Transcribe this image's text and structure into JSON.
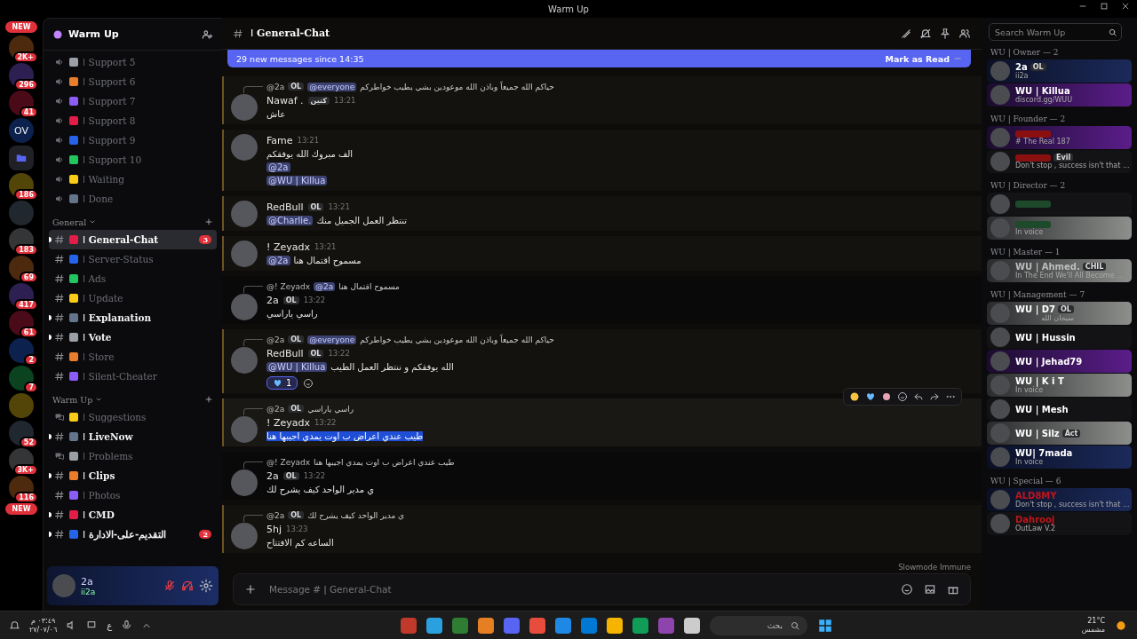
{
  "window": {
    "title": "Warm Up"
  },
  "servers": [
    {
      "kind": "new",
      "badge": "NEW"
    },
    {
      "kind": "server",
      "badge": "2K+"
    },
    {
      "kind": "server",
      "badge": "296"
    },
    {
      "kind": "server",
      "badge": "41"
    },
    {
      "kind": "server",
      "label": "OV"
    },
    {
      "kind": "folder"
    },
    {
      "kind": "server",
      "badge": "186"
    },
    {
      "kind": "server"
    },
    {
      "kind": "server",
      "badge": "183"
    },
    {
      "kind": "server",
      "badge": "69"
    },
    {
      "kind": "server",
      "badge": "417"
    },
    {
      "kind": "server",
      "badge": "61"
    },
    {
      "kind": "server",
      "badge": "2"
    },
    {
      "kind": "server",
      "badge": "7"
    },
    {
      "kind": "server"
    },
    {
      "kind": "server",
      "badge": "52"
    },
    {
      "kind": "server",
      "badge": "3K+"
    },
    {
      "kind": "server",
      "badge": "116"
    },
    {
      "kind": "new",
      "badge": "NEW"
    }
  ],
  "server": {
    "name": "Warm Up"
  },
  "channel_groups": [
    {
      "channels": [
        {
          "kind": "voice",
          "name": "ǀ Support 5",
          "unread": false,
          "selected": false
        },
        {
          "kind": "voice",
          "name": "ǀ Support 6",
          "unread": false,
          "selected": false
        },
        {
          "kind": "voice",
          "name": "ǀ Support 7",
          "unread": false,
          "selected": false
        },
        {
          "kind": "voice",
          "name": "ǀ Support 8",
          "unread": false,
          "selected": false
        },
        {
          "kind": "voice",
          "name": "ǀ Support 9",
          "unread": false,
          "selected": false
        },
        {
          "kind": "voice",
          "name": "ǀ Support 10",
          "unread": false,
          "selected": false
        },
        {
          "kind": "voice",
          "name": "ǀ Waiting",
          "unread": false,
          "selected": false
        },
        {
          "kind": "voice",
          "name": "ǀ Done",
          "unread": false,
          "selected": false
        }
      ]
    },
    {
      "name": "General",
      "channels": [
        {
          "kind": "text",
          "name": "ǀ General-Chat",
          "unread": true,
          "selected": true,
          "badge": "3"
        },
        {
          "kind": "text",
          "name": "ǀ Server-Status",
          "unread": false,
          "selected": false
        },
        {
          "kind": "text",
          "name": "ǀ Ads",
          "unread": false,
          "selected": false
        },
        {
          "kind": "text",
          "name": "ǀ Update",
          "unread": false,
          "selected": false
        },
        {
          "kind": "text",
          "name": "ǀ Explanation",
          "unread": true,
          "selected": false
        },
        {
          "kind": "text",
          "name": "ǀ Vote",
          "unread": true,
          "selected": false
        },
        {
          "kind": "text",
          "name": "ǀ Store",
          "unread": false,
          "selected": false
        },
        {
          "kind": "text",
          "name": "ǀ Silent-Cheater",
          "unread": false,
          "selected": false
        }
      ]
    },
    {
      "name": "Warm Up",
      "channels": [
        {
          "kind": "forum",
          "name": "ǀ Suggestions",
          "unread": false,
          "selected": false
        },
        {
          "kind": "text",
          "name": "ǀ LiveNow",
          "unread": true,
          "selected": false
        },
        {
          "kind": "forum",
          "name": "ǀ Problems",
          "unread": false,
          "selected": false
        },
        {
          "kind": "text",
          "name": "ǀ Clips",
          "unread": true,
          "selected": false
        },
        {
          "kind": "text",
          "name": "ǀ Photos",
          "unread": false,
          "selected": false
        },
        {
          "kind": "text",
          "name": "ǀ CMD",
          "unread": true,
          "selected": false
        },
        {
          "kind": "text",
          "name": "ǀ التقديم-على-الادارة",
          "unread": true,
          "selected": false,
          "badge": "2"
        }
      ]
    }
  ],
  "user_panel": {
    "name": "2a",
    "status": "ii2a",
    "muted": true,
    "deafened": true
  },
  "channel_header": {
    "name": "ǀ General-Chat"
  },
  "new_messages_bar": {
    "text": "29 new messages since 14:35",
    "action": "Mark as Read"
  },
  "messages": [
    {
      "mentions_me": true,
      "reply": {
        "author": "@2a",
        "tag": "OL",
        "segments": [
          {
            "kind": "mention",
            "text": "@everyone"
          },
          {
            "kind": "text",
            "text": "حياكم الله جميعاً وباذن الله موعودين بشي يطيب خواطركم"
          }
        ]
      },
      "author": "Nawaf .",
      "tag": "كتين",
      "time": "13:21",
      "lines": [
        [
          {
            "kind": "text",
            "text": "عاش"
          }
        ]
      ],
      "selected_text": false,
      "hovered": false
    },
    {
      "mentions_me": true,
      "author": "Fame",
      "time": "13:21",
      "lines": [
        [
          {
            "kind": "text",
            "text": "الف مبروك الله يوفقكم"
          }
        ],
        [
          {
            "kind": "mention",
            "text": "@2a"
          }
        ],
        [
          {
            "kind": "mention",
            "text": "@WU | Killua"
          }
        ]
      ],
      "selected_text": false,
      "hovered": false
    },
    {
      "mentions_me": true,
      "author": "RedBull",
      "tag": "OL",
      "time": "13:21",
      "lines": [
        [
          {
            "kind": "mention",
            "text": "@Charlie."
          },
          {
            "kind": "text",
            "text": "تنتظر العمل الجميل منك"
          }
        ]
      ],
      "selected_text": false,
      "hovered": false
    },
    {
      "mentions_me": true,
      "author": "! Zeyadx",
      "time": "13:21",
      "lines": [
        [
          {
            "kind": "mention",
            "text": "@2a"
          },
          {
            "kind": "text",
            "text": "مسموح اقتمال هنا"
          }
        ]
      ],
      "selected_text": false,
      "hovered": false
    },
    {
      "mentions_me": false,
      "reply": {
        "author": "@! Zeyadx",
        "segments": [
          {
            "kind": "mention",
            "text": "@2a"
          },
          {
            "kind": "text",
            "text": "مسموح اقتمال هنا"
          }
        ]
      },
      "author": "2a",
      "tag": "OL",
      "time": "13:22",
      "lines": [
        [
          {
            "kind": "text",
            "text": "راسي ياراسي"
          }
        ]
      ],
      "selected_text": false,
      "hovered": false
    },
    {
      "mentions_me": true,
      "reply": {
        "author": "@2a",
        "tag": "OL",
        "segments": [
          {
            "kind": "mention",
            "text": "@everyone"
          },
          {
            "kind": "text",
            "text": "حياكم الله جميعاً وباذن الله موعودين بشي يطيب خواطركم"
          }
        ]
      },
      "author": "RedBull",
      "tag": "OL",
      "time": "13:22",
      "lines": [
        [
          {
            "kind": "mention",
            "text": "@WU | Killua"
          },
          {
            "kind": "text",
            "text": "الله يوفقكم و ننتظر العمل الطيب"
          }
        ]
      ],
      "reactions": [
        {
          "count": "1"
        }
      ],
      "selected_text": false,
      "hovered": false
    },
    {
      "mentions_me": true,
      "reply": {
        "author": "@2a",
        "tag": "OL",
        "segments": [
          {
            "kind": "text",
            "text": "راسي ياراسي"
          }
        ]
      },
      "author": "! Zeyadx",
      "time": "13:22",
      "lines": [
        [
          {
            "kind": "text",
            "text": "طيب عندي اعراض ب اوت يمدي اجيبها هنا"
          }
        ]
      ],
      "selected_text": true,
      "hovered": true
    },
    {
      "mentions_me": false,
      "reply": {
        "author": "@! Zeyadx",
        "segments": [
          {
            "kind": "text",
            "text": "طيب عندي اعراض ب اوت يمدي اجيبها هنا"
          }
        ]
      },
      "author": "2a",
      "tag": "OL",
      "time": "13:22",
      "lines": [
        [
          {
            "kind": "text",
            "text": "ي مدير الواحد كيف يشرح لك"
          }
        ]
      ],
      "selected_text": false,
      "hovered": false
    },
    {
      "mentions_me": true,
      "reply": {
        "author": "@2a",
        "tag": "OL",
        "segments": [
          {
            "kind": "text",
            "text": "ي مدير الواحد كيف يشرح لك"
          }
        ]
      },
      "author": "5hj",
      "time": "13:23",
      "lines": [
        [
          {
            "kind": "text",
            "text": "الساعه كم الافتتاح"
          }
        ]
      ],
      "selected_text": false,
      "hovered": false
    }
  ],
  "slowmode": "Slowmode Immune",
  "composer": {
    "placeholder": "Message # ǀ General-Chat"
  },
  "search": {
    "placeholder": "Search Warm Up"
  },
  "member_groups": [
    {
      "title": "WU | Owner — 2",
      "members": [
        {
          "name": "2a",
          "tag": "OL",
          "status": "ii2a",
          "color": "#ffffff",
          "kind": "blue"
        },
        {
          "name": "WU | Killua",
          "status": "discord.gg/WUU",
          "color": "#ffffff",
          "kind": "purple"
        }
      ]
    },
    {
      "title": "WU | Founder — 2",
      "members": [
        {
          "status": "# The Real 187",
          "color": "#8a1010",
          "kind": "purple"
        },
        {
          "tag": "Evil",
          "status": "Don't stop , success isn't that ...",
          "color": "#8a1010",
          "kind": "plain"
        }
      ]
    },
    {
      "title": "WU | Director — 2",
      "members": [
        {
          "color": "#1d4a2a",
          "kind": "plain"
        },
        {
          "status": "In voice",
          "color": "#1d4a2a",
          "kind": "grey"
        }
      ]
    },
    {
      "title": "WU | Master — 1",
      "members": [
        {
          "name": "WU | Ahmed.",
          "tag": "CHIL",
          "status": "In The End We'll All Become ...",
          "color": "#bdbdbd",
          "kind": "grey"
        }
      ]
    },
    {
      "title": "WU | Management — 7",
      "members": [
        {
          "name": "WU | D7",
          "tag": "OL",
          "status": "سبحان الله",
          "color": "#ffffff",
          "kind": "grey"
        },
        {
          "name": "WU | Hussin",
          "color": "#ffffff",
          "kind": "plain"
        },
        {
          "name": "WU | Jehad79",
          "color": "#ffffff",
          "kind": "purple"
        },
        {
          "name": "WU | K i T",
          "status": "In voice",
          "color": "#ffffff",
          "kind": "grey"
        },
        {
          "name": "WU | Mesh",
          "color": "#ffffff",
          "kind": "plain"
        },
        {
          "name": "WU | Silz",
          "tag": "Act",
          "color": "#ffffff",
          "kind": "grey"
        },
        {
          "name": "WU| 7mada",
          "status": "In voice",
          "color": "#ffffff",
          "kind": "blue"
        }
      ]
    },
    {
      "title": "WU | Special — 6",
      "members": [
        {
          "name": "ALD8MY",
          "status": "Don't stop , success isn't that ...",
          "color": "#c0151a",
          "kind": "blue"
        },
        {
          "name": "Dahrooj",
          "status": "OutLaw V.2",
          "color": "#c0151a",
          "kind": "plain"
        }
      ]
    }
  ],
  "taskbar": {
    "time": "٠٣:٤٩ م",
    "date": "٢٧/٠٧/٠٦",
    "language": "ع",
    "search_placeholder": "بحث",
    "temperature": "21°C",
    "weather": "مشمس"
  }
}
